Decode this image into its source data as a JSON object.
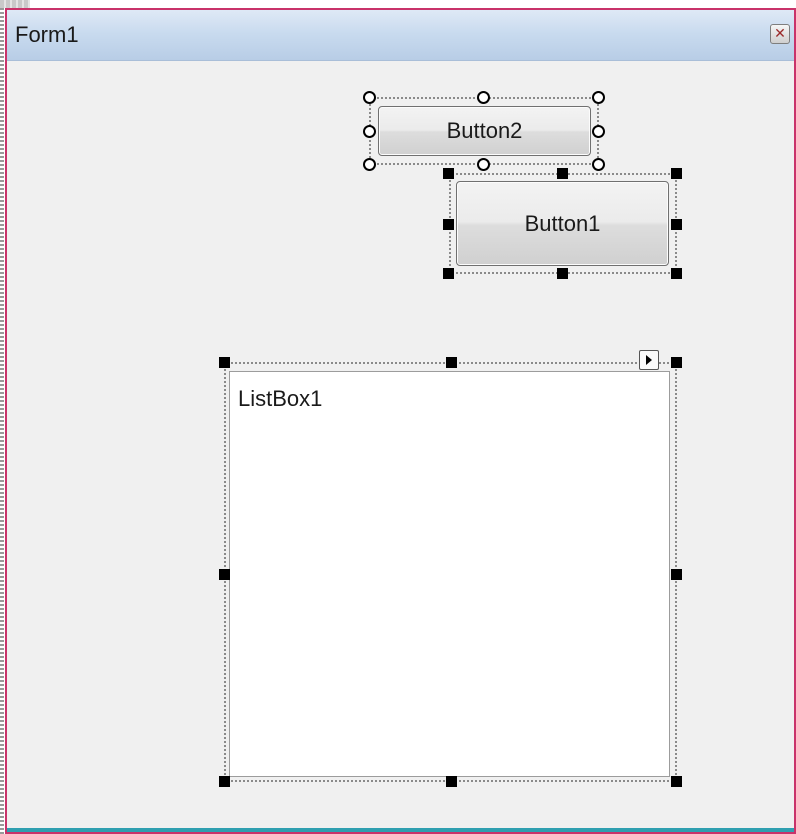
{
  "form": {
    "title": "Form1",
    "close_icon": "close-icon"
  },
  "controls": {
    "button2_label": "Button2",
    "button1_label": "Button1",
    "listbox_label": "ListBox1"
  },
  "colors": {
    "form_border": "#c9336a",
    "title_bar": "#c9dbef",
    "client_area": "#f0f0f0",
    "bottom_bar": "#2f9fb0"
  },
  "icons": {
    "smart_tag": "smart-tag-arrow-icon"
  }
}
